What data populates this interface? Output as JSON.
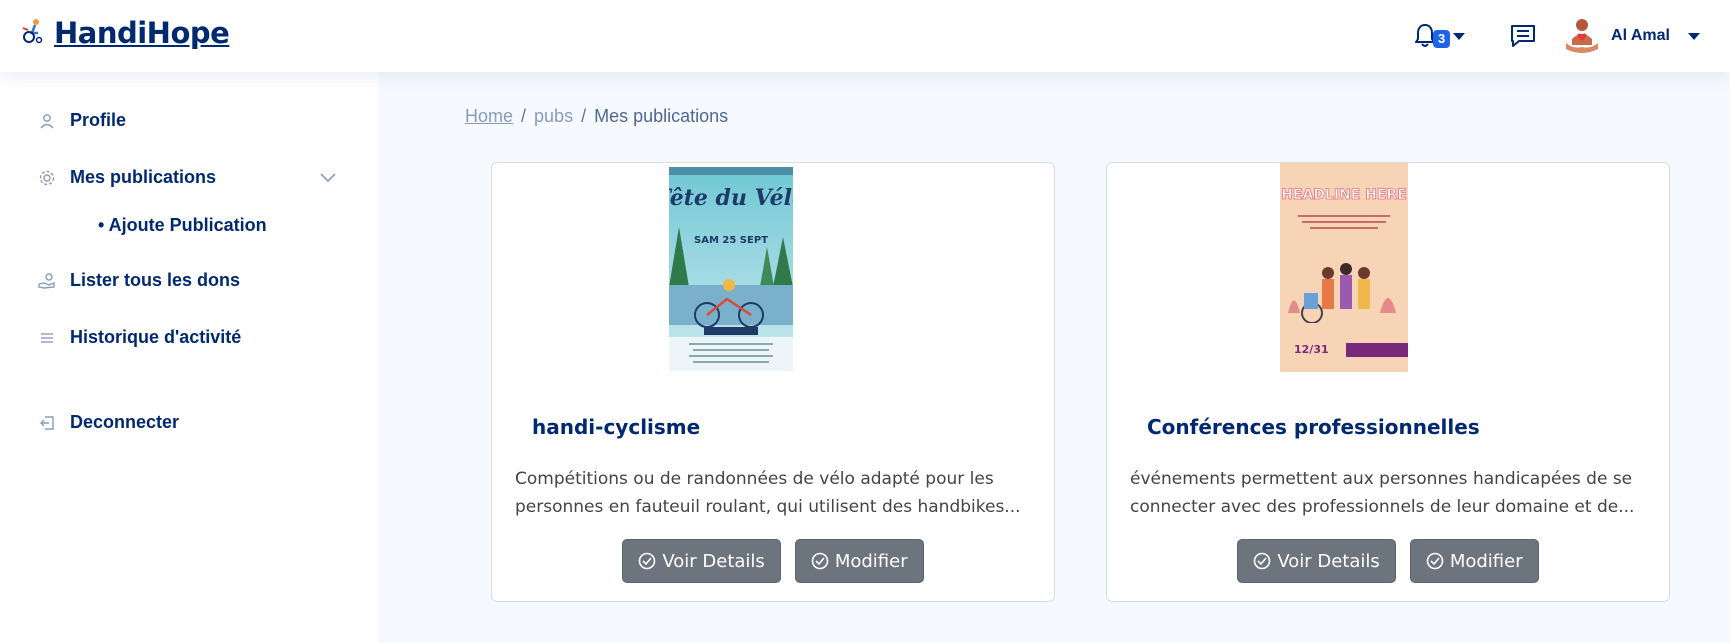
{
  "header": {
    "brand": "HandiHope",
    "notification_count": "3",
    "user_name": "Al Amal"
  },
  "sidebar": {
    "items": [
      {
        "label": "Profile",
        "icon": "person-icon"
      },
      {
        "label": "Mes publications",
        "icon": "gear-icon"
      },
      {
        "label": "Lister tous les dons",
        "icon": "donation-hand-icon"
      },
      {
        "label": "Historique d'activité",
        "icon": "list-icon"
      },
      {
        "label": "Deconnecter",
        "icon": "logout-icon"
      }
    ],
    "sub_items": [
      {
        "label": "• Ajoute Publication"
      }
    ]
  },
  "breadcrumb": {
    "home": "Home",
    "middle": "pubs",
    "current": "Mes publications",
    "separator": "/"
  },
  "cards": [
    {
      "poster_title": "Fête du Vélo",
      "poster_date": "SAM 25 SEPT",
      "title": "handi-cyclisme",
      "text": "Compétitions ou de randonnées de vélo adapté pour les personnes en fauteuil roulant, qui utilisent des handbikes...",
      "details_label": "Voir Details",
      "edit_label": "Modifier"
    },
    {
      "poster_title": "HEADLINE HERE",
      "poster_date": "12/31",
      "title": "Conférences professionnelles",
      "text": "événements permettent aux personnes handicapées de se connecter avec des professionnels de leur domaine et de...",
      "details_label": "Voir Details",
      "edit_label": "Modifier"
    }
  ],
  "colors": {
    "brand": "#012970",
    "background": "#f6f9ff",
    "button": "#6c757d",
    "badge": "#1e63e9"
  }
}
